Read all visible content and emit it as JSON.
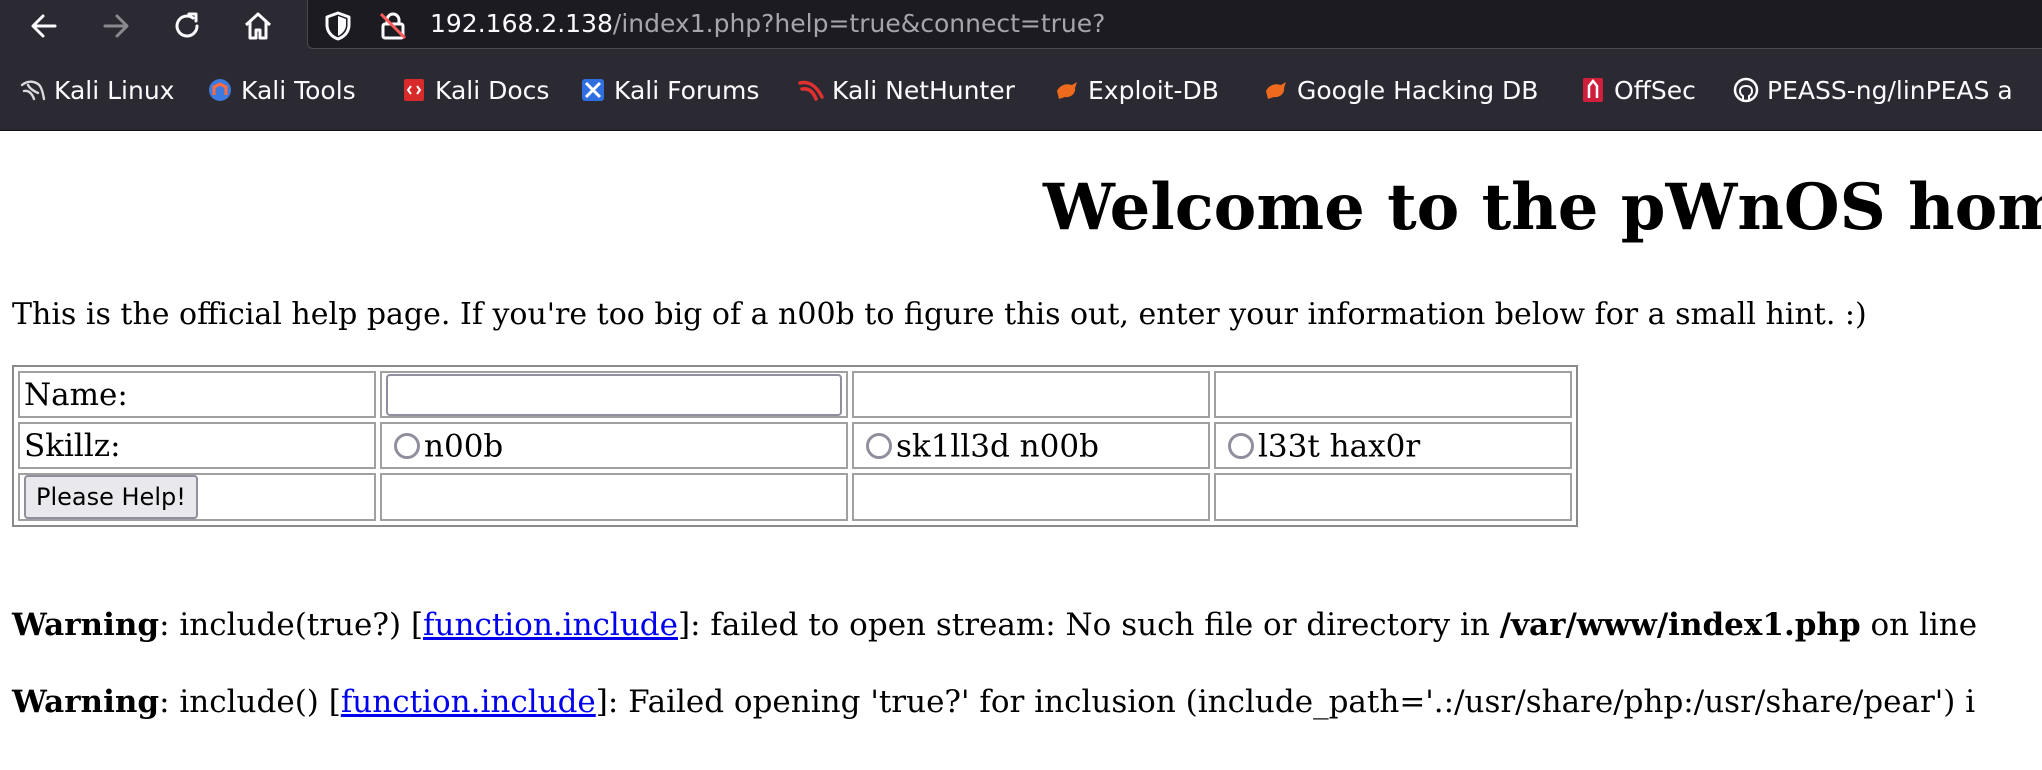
{
  "browser": {
    "url_host": "192.168.2.138",
    "url_path": "/index1.php?help=true&connect=true?",
    "bookmarks": [
      {
        "label": "Kali Linux",
        "icon": "kali-dragon-icon"
      },
      {
        "label": "Kali Tools",
        "icon": "kali-tools-icon"
      },
      {
        "label": "Kali Docs",
        "icon": "kali-docs-icon"
      },
      {
        "label": "Kali Forums",
        "icon": "kali-forums-icon"
      },
      {
        "label": "Kali NetHunter",
        "icon": "kali-nethunter-icon"
      },
      {
        "label": "Exploit-DB",
        "icon": "exploit-db-icon"
      },
      {
        "label": "Google Hacking DB",
        "icon": "ghdb-icon"
      },
      {
        "label": "OffSec",
        "icon": "offsec-icon"
      },
      {
        "label": "PEASS-ng/linPEAS a",
        "icon": "github-icon"
      }
    ]
  },
  "page": {
    "title": "Welcome to the pWnOS hom",
    "intro": "This is the official help page. If you're too big of a n00b to figure this out, enter your information below for a small hint. :)",
    "form": {
      "name_label": "Name:",
      "name_value": "",
      "skill_label": "Skillz:",
      "skills": [
        "n00b",
        "sk1ll3d n00b",
        "l33t hax0r"
      ],
      "submit_label": "Please Help!"
    },
    "warnings": [
      {
        "label": "Warning",
        "before": ": include(true?) [",
        "link": "function.include",
        "after": "]: failed to open stream: No such file or directory in ",
        "bold_path": "/var/www/index1.php",
        "tail": " on line"
      },
      {
        "label": "Warning",
        "before": ": include() [",
        "link": "function.include",
        "after": "]: Failed opening 'true?' for inclusion (include_path='.:/usr/share/php:/usr/share/pear') i",
        "bold_path": "",
        "tail": ""
      }
    ]
  },
  "colors": {
    "chrome_bg": "#2b2a33",
    "urlbar_bg": "#1c1b22",
    "link": "#0000ee"
  }
}
